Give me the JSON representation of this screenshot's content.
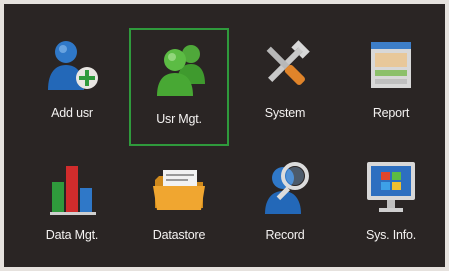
{
  "menu": {
    "items": [
      {
        "label": "Add usr",
        "icon": "add-user-icon"
      },
      {
        "label": "Usr Mgt.",
        "icon": "users-icon",
        "selected": true
      },
      {
        "label": "System",
        "icon": "tools-icon"
      },
      {
        "label": "Report",
        "icon": "report-icon"
      },
      {
        "label": "Data Mgt.",
        "icon": "bar-chart-icon"
      },
      {
        "label": "Datastore",
        "icon": "folder-icon"
      },
      {
        "label": "Record",
        "icon": "search-user-icon"
      },
      {
        "label": "Sys. Info.",
        "icon": "monitor-icon"
      }
    ]
  },
  "colors": {
    "background": "#2a2524",
    "border": "#e6e2de",
    "selection": "#2f9a3c",
    "text": "#f4f2f1"
  }
}
